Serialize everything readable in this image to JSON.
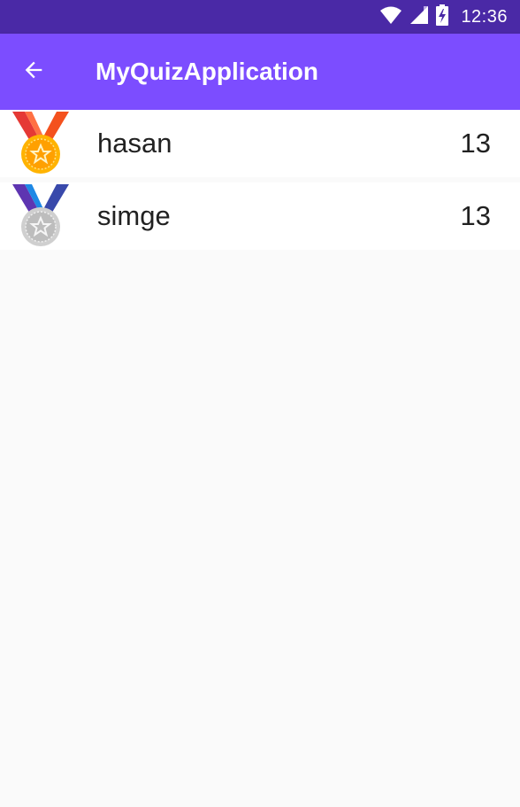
{
  "status_bar": {
    "time": "12:36",
    "icons": [
      "wifi-icon",
      "cell-signal-icon",
      "battery-charging-icon"
    ]
  },
  "app_bar": {
    "title": "MyQuizApplication",
    "back_icon": "arrow-back-icon",
    "background_color": "#7c4dff",
    "status_color": "#4a29a6"
  },
  "leaderboard": {
    "entries": [
      {
        "name": "hasan",
        "score": "13",
        "medal": "gold-medal-icon"
      },
      {
        "name": "simge",
        "score": "13",
        "medal": "silver-medal-icon"
      }
    ]
  }
}
